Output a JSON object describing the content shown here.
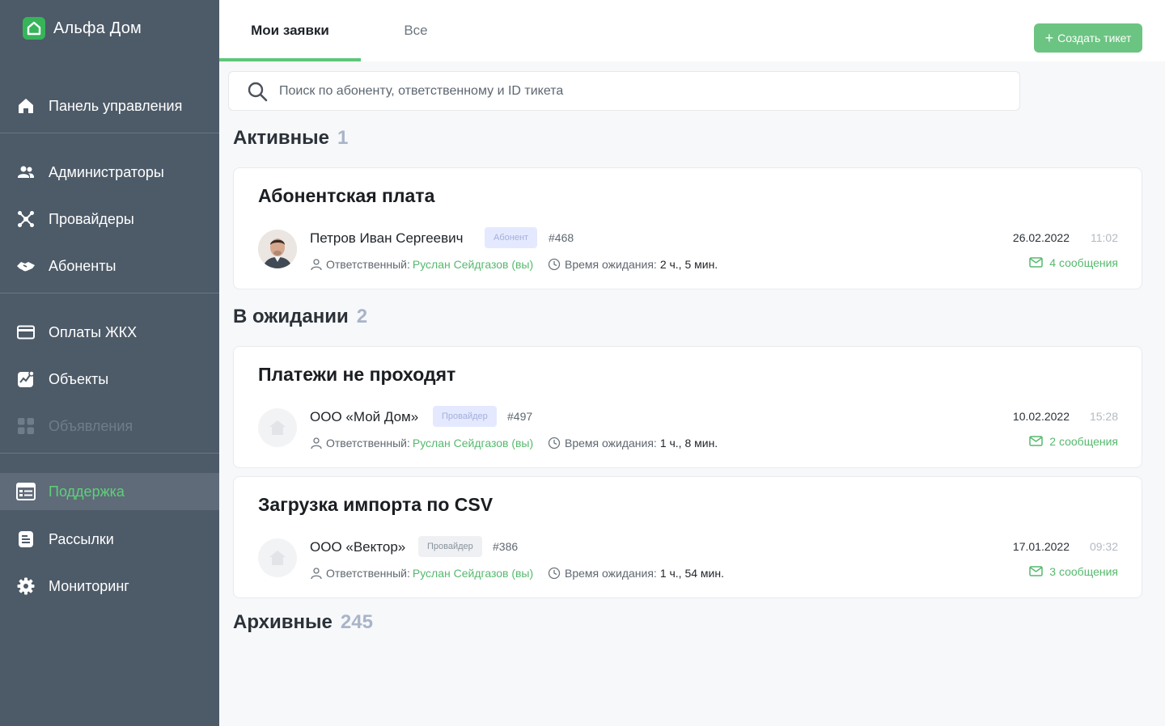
{
  "app": {
    "name": "Альфа Дом",
    "brand_color": "#36b45a"
  },
  "sidebar": {
    "items": [
      {
        "label": "Панель управления",
        "icon": "home-icon"
      },
      {
        "label": "Администраторы",
        "icon": "users-icon"
      },
      {
        "label": "Провайдеры",
        "icon": "network-icon"
      },
      {
        "label": "Абоненты",
        "icon": "handshake-icon"
      },
      {
        "label": "Оплаты ЖКХ",
        "icon": "credit-card-icon"
      },
      {
        "label": "Объекты",
        "icon": "chart-icon"
      },
      {
        "label": "Объявления",
        "icon": "grid-icon",
        "disabled": true
      },
      {
        "label": "Поддержка",
        "icon": "support-icon",
        "active": true
      },
      {
        "label": "Рассылки",
        "icon": "document-icon"
      },
      {
        "label": "Мониторинг",
        "icon": "gear-icon"
      }
    ]
  },
  "tabs": {
    "mine": "Мои заявки",
    "all": "Все",
    "active": "mine"
  },
  "create_button": {
    "label": "Создать тикет",
    "icon": "plus-icon"
  },
  "search": {
    "placeholder": "Поиск по абоненту, ответственному и ID тикета",
    "value": ""
  },
  "sections": {
    "active": {
      "title": "Активные",
      "count": "1"
    },
    "waiting": {
      "title": "В ожидании",
      "count": "2"
    },
    "archive": {
      "title": "Архивные",
      "count": "245"
    }
  },
  "labels": {
    "responsible": "Ответственный:",
    "wait": "Время ожидания:"
  },
  "tickets": [
    {
      "title": "Абонентская плата",
      "name": "Петров Иван Сергеевич",
      "badge": "Абонент",
      "id": "#468",
      "responsible": "Руслан Сейдгазов (вы)",
      "wait": "2 ч., 5 мин.",
      "date": "26.02.2022",
      "time": "11:02",
      "messages": "4 сообщения"
    },
    {
      "title": "Платежи не проходят",
      "name": "ООО «Мой Дом»",
      "badge": "Провайдер",
      "id": "#497",
      "responsible": "Руслан Сейдгазов (вы)",
      "wait": "1 ч., 8 мин.",
      "date": "10.02.2022",
      "time": "15:28",
      "messages": "2 сообщения"
    },
    {
      "title": "Загрузка импорта по CSV",
      "name": "ООО «Вектор»",
      "badge": "Провайдер",
      "id": "#386",
      "responsible": "Руслан Сейдгазов (вы)",
      "wait": "1 ч., 54 мин.",
      "date": "17.01.2022",
      "time": "09:32",
      "messages": "3 сообщения"
    }
  ]
}
